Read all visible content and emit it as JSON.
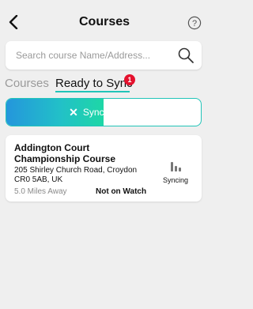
{
  "header": {
    "title": "Courses",
    "back_icon": "chevron-left-icon",
    "help_icon": "question-circle-icon"
  },
  "search": {
    "placeholder": "Search course Name/Address...",
    "icon": "search-icon"
  },
  "tabs": {
    "courses_label": "Courses",
    "ready_label": "Ready to Sync",
    "ready_badge": "1"
  },
  "sync": {
    "label": "Syncing 50%",
    "progress": 0.5
  },
  "course": {
    "name": "Addington Court Championship Course",
    "address": "205 Shirley Church Road, Croydon CR0 5AB, UK",
    "distance": "5.0 Miles Away",
    "watch_status": "Not on Watch",
    "sync_status": "Syncing"
  },
  "colors": {
    "accent": "#21c4b8",
    "badge": "#e4112d",
    "background": "#efefef"
  }
}
